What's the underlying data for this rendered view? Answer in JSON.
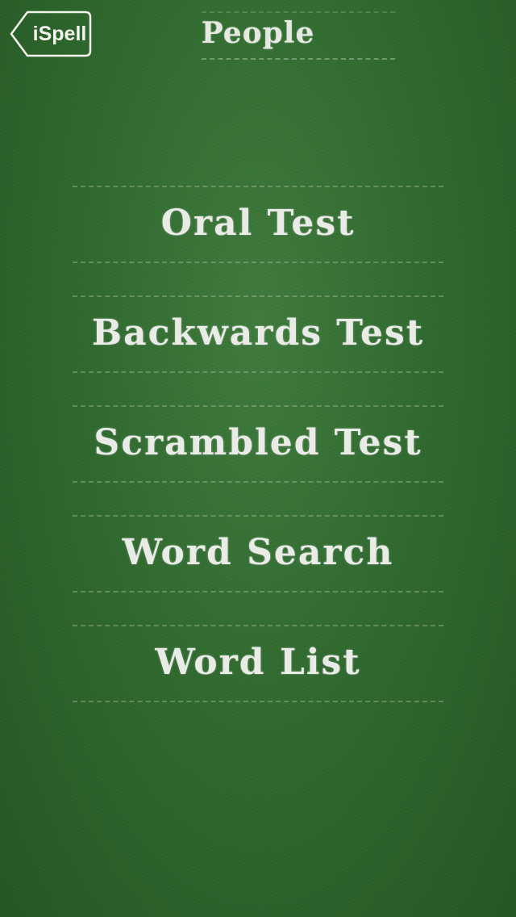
{
  "nav": {
    "back_label": "iSpell",
    "title": "People"
  },
  "menu": {
    "items": [
      {
        "label": "Oral Test"
      },
      {
        "label": "Backwards Test"
      },
      {
        "label": "Scrambled Test"
      },
      {
        "label": "Word Search"
      },
      {
        "label": "Word List"
      }
    ]
  },
  "colors": {
    "chalkboard": "#306a2f",
    "chalk": "#e9ece6"
  }
}
